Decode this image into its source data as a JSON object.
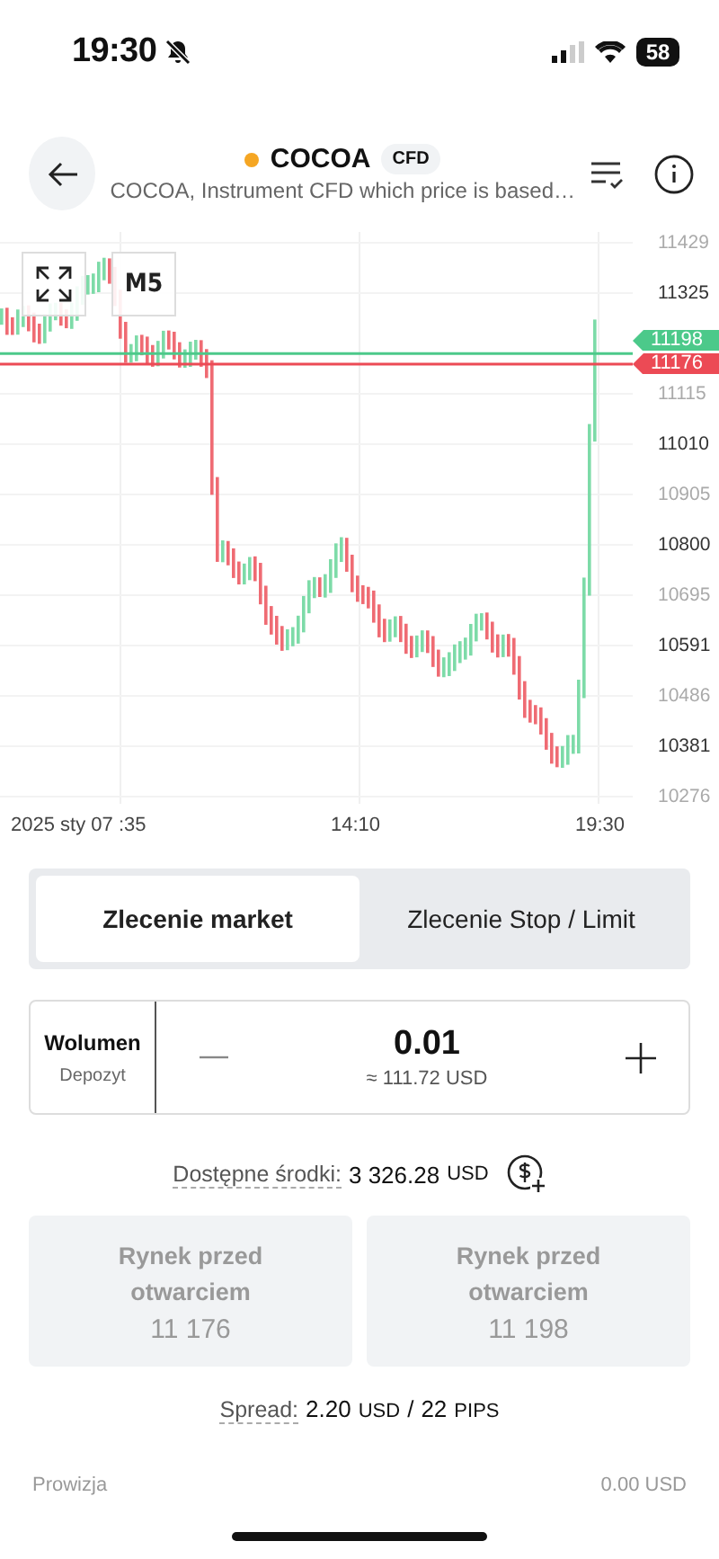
{
  "status_bar": {
    "time": "19:30",
    "battery": "58"
  },
  "header": {
    "symbol": "COCOA",
    "badge": "CFD",
    "subtitle": "COCOA, Instrument CFD which price is based…"
  },
  "chart": {
    "timeframe": "M5",
    "y_ticks": [
      "11429",
      "11325",
      "11115",
      "11010",
      "10905",
      "10800",
      "10695",
      "10591",
      "10486",
      "10381",
      "10276"
    ],
    "x_labels": [
      "2025 sty 07",
      ":35",
      "14:10",
      "19:30"
    ],
    "price_tags": [
      {
        "label": "11198",
        "kind": "ask"
      },
      {
        "label": "11176",
        "kind": "bid"
      }
    ]
  },
  "order_tabs": [
    {
      "label": "Zlecenie market",
      "selected": true
    },
    {
      "label": "Zlecenie Stop / Limit",
      "selected": false
    }
  ],
  "volume": {
    "label": "Wolumen",
    "sublabel": "Depozyt",
    "value": "0.01",
    "approx": "≈ 111.72 USD"
  },
  "funds": {
    "label": "Dostępne środki:",
    "amount": "3 326.28",
    "currency": "USD"
  },
  "price_buttons": [
    {
      "title": "Rynek przed otwarciem",
      "price": "11 176",
      "disabled": true
    },
    {
      "title": "Rynek przed otwarciem",
      "price": "11 198",
      "disabled": true
    }
  ],
  "spread": {
    "label": "Spread:",
    "amount": "2.20",
    "unit": "USD",
    "separator": "/",
    "pips": "22",
    "pips_unit": "PIPS"
  },
  "commission": {
    "label": "Prowizja",
    "value": "0.00 USD"
  }
}
